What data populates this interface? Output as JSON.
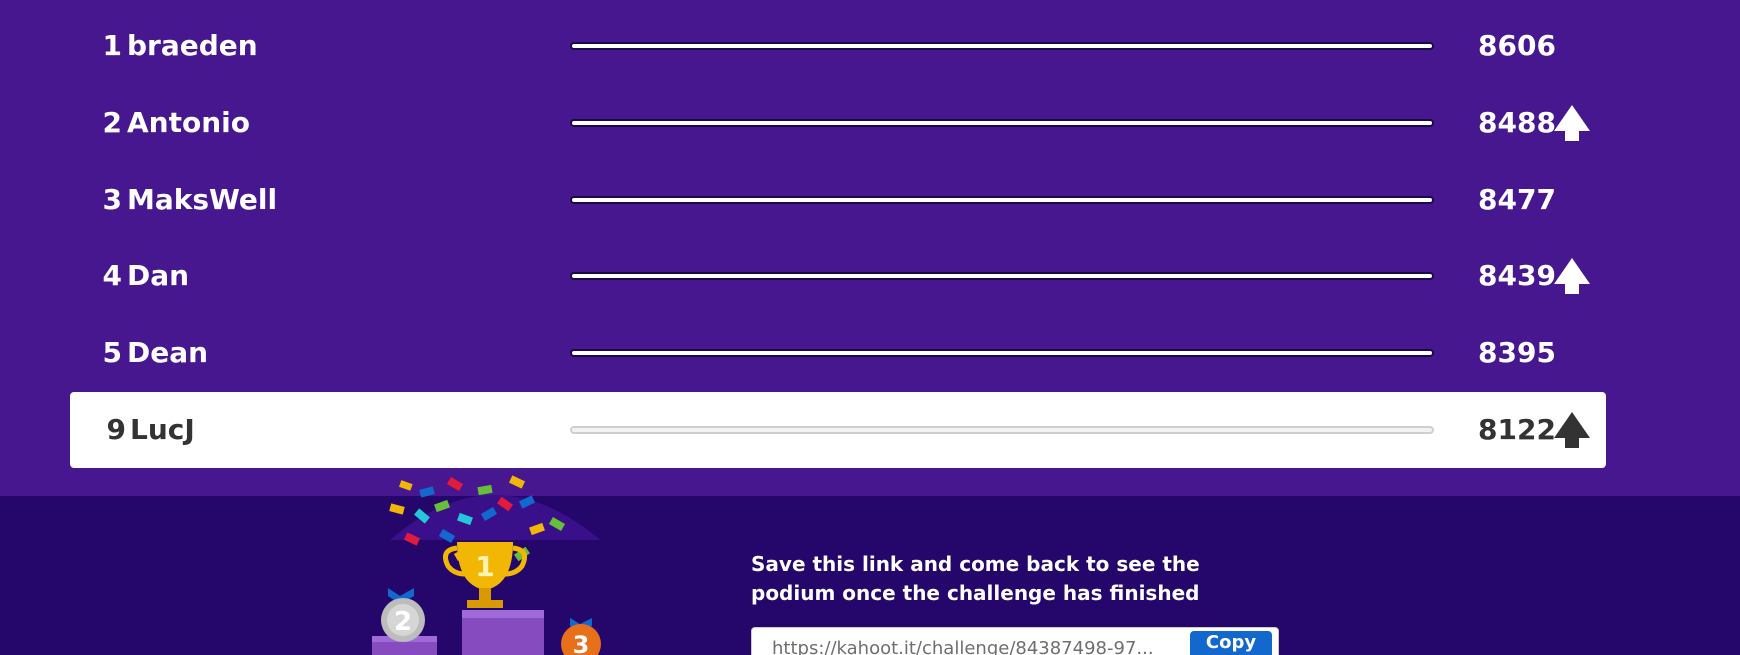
{
  "leaderboard": {
    "rows": [
      {
        "rank": "1",
        "name": "braeden",
        "score": "8606",
        "arrow": false
      },
      {
        "rank": "2",
        "name": "Antonio",
        "score": "8488",
        "arrow": true
      },
      {
        "rank": "3",
        "name": "MaksWell",
        "score": "8477",
        "arrow": false
      },
      {
        "rank": "4",
        "name": "Dan",
        "score": "8439",
        "arrow": true
      },
      {
        "rank": "5",
        "name": "Dean",
        "score": "8395",
        "arrow": false
      }
    ],
    "current_player": {
      "rank": "9",
      "name": "LucJ",
      "score": "8122",
      "arrow": true
    }
  },
  "footer": {
    "save_text": "Save this link and come back to see the podium once the challenge has finished",
    "link_value": "https://kahoot.it/challenge/84387498-97...",
    "copy_label": "Copy",
    "podium_labels": {
      "first": "1",
      "second": "2",
      "third": "3"
    }
  },
  "colors": {
    "background": "#46178f",
    "footer_background": "#25076b",
    "copy_button": "#1368ce",
    "gold": "#f2b705",
    "silver": "#bdbdbd",
    "bronze": "#e8701a"
  },
  "icons": {
    "rank_up": "arrow-up-icon",
    "trophy": "trophy-icon"
  }
}
